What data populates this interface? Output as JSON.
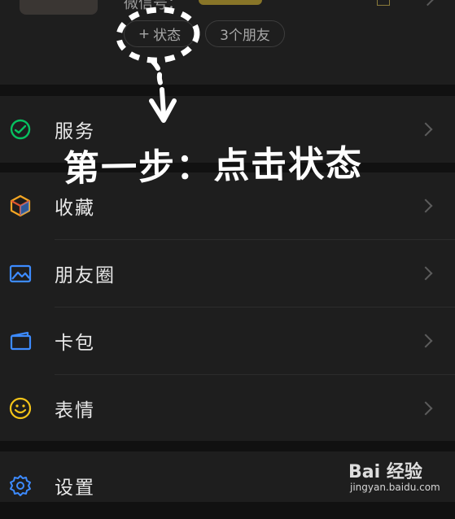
{
  "profile": {
    "wechat_id_label": "微信号：",
    "status_button": "状态",
    "status_plus": "+",
    "friends_label": "3个朋友"
  },
  "menu": {
    "services": "服务",
    "favorites": "收藏",
    "moments": "朋友圈",
    "cards": "卡包",
    "stickers": "表情",
    "settings": "设置"
  },
  "annotation": {
    "instruction": "第一步：点击状态"
  },
  "watermark": {
    "brand": "Bai 经验",
    "url": "jingyan.baidu.com"
  },
  "colors": {
    "services_icon": "#07c160",
    "favorites_icon": "#f5a623",
    "moments_icon": "#3d8bff",
    "cards_icon": "#3d8bff",
    "stickers_icon": "#f5c518",
    "settings_icon": "#3d8bff"
  }
}
